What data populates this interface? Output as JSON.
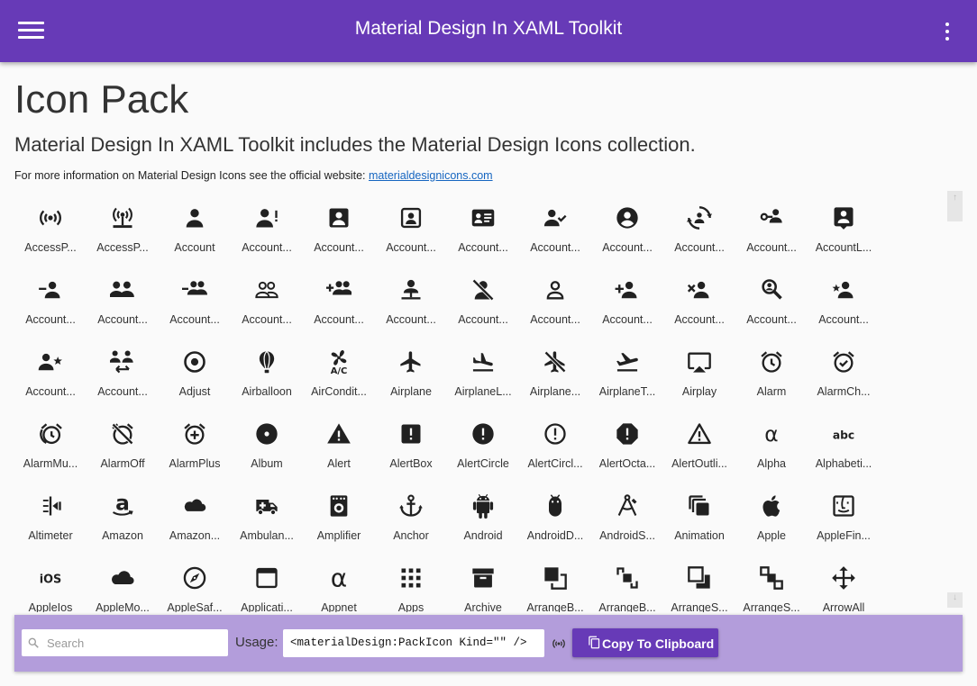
{
  "app": {
    "title": "Material Design In XAML Toolkit",
    "accent": "#673ab7",
    "panel_color": "#b39ddb"
  },
  "header": {
    "menu_icon": "hamburger-menu-icon",
    "more_icon": "more-vert-icon"
  },
  "page": {
    "title": "Icon Pack",
    "subtitle": "Material Design In XAML Toolkit includes the Material Design Icons collection.",
    "info_text": "For more information on Material Design Icons see the official website: ",
    "info_link": "materialdesignicons.com"
  },
  "icons": [
    {
      "label": "AccessP...",
      "icon": "access-point-icon"
    },
    {
      "label": "AccessP...",
      "icon": "access-point-network-icon"
    },
    {
      "label": "Account",
      "icon": "account-icon"
    },
    {
      "label": "Account...",
      "icon": "account-alert-icon"
    },
    {
      "label": "Account...",
      "icon": "account-box-icon"
    },
    {
      "label": "Account...",
      "icon": "account-box-outline-icon"
    },
    {
      "label": "Account...",
      "icon": "account-card-details-icon"
    },
    {
      "label": "Account...",
      "icon": "account-check-icon"
    },
    {
      "label": "Account...",
      "icon": "account-circle-icon"
    },
    {
      "label": "Account...",
      "icon": "account-convert-icon"
    },
    {
      "label": "Account...",
      "icon": "account-key-icon"
    },
    {
      "label": "AccountL...",
      "icon": "account-location-icon"
    },
    {
      "label": "Account...",
      "icon": "account-minus-icon"
    },
    {
      "label": "Account...",
      "icon": "account-multiple-icon"
    },
    {
      "label": "Account...",
      "icon": "account-multiple-minus-icon"
    },
    {
      "label": "Account...",
      "icon": "account-multiple-outline-icon"
    },
    {
      "label": "Account...",
      "icon": "account-multiple-plus-icon"
    },
    {
      "label": "Account...",
      "icon": "account-network-icon"
    },
    {
      "label": "Account...",
      "icon": "account-off-icon"
    },
    {
      "label": "Account...",
      "icon": "account-outline-icon"
    },
    {
      "label": "Account...",
      "icon": "account-plus-icon"
    },
    {
      "label": "Account...",
      "icon": "account-remove-icon"
    },
    {
      "label": "Account...",
      "icon": "account-search-icon"
    },
    {
      "label": "Account...",
      "icon": "account-star-icon"
    },
    {
      "label": "Account...",
      "icon": "account-star-variant-icon"
    },
    {
      "label": "Account...",
      "icon": "account-switch-icon"
    },
    {
      "label": "Adjust",
      "icon": "adjust-icon"
    },
    {
      "label": "Airballoon",
      "icon": "airballoon-icon"
    },
    {
      "label": "AirCondit...",
      "icon": "air-conditioner-icon"
    },
    {
      "label": "Airplane",
      "icon": "airplane-icon"
    },
    {
      "label": "AirplaneL...",
      "icon": "airplane-landing-icon"
    },
    {
      "label": "Airplane...",
      "icon": "airplane-off-icon"
    },
    {
      "label": "AirplaneT...",
      "icon": "airplane-takeoff-icon"
    },
    {
      "label": "Airplay",
      "icon": "airplay-icon"
    },
    {
      "label": "Alarm",
      "icon": "alarm-icon"
    },
    {
      "label": "AlarmCh...",
      "icon": "alarm-check-icon"
    },
    {
      "label": "AlarmMu...",
      "icon": "alarm-multiple-icon"
    },
    {
      "label": "AlarmOff",
      "icon": "alarm-off-icon"
    },
    {
      "label": "AlarmPlus",
      "icon": "alarm-plus-icon"
    },
    {
      "label": "Album",
      "icon": "album-icon"
    },
    {
      "label": "Alert",
      "icon": "alert-icon"
    },
    {
      "label": "AlertBox",
      "icon": "alert-box-icon"
    },
    {
      "label": "AlertCircle",
      "icon": "alert-circle-icon"
    },
    {
      "label": "AlertCircl...",
      "icon": "alert-circle-outline-icon"
    },
    {
      "label": "AlertOcta...",
      "icon": "alert-octagon-icon"
    },
    {
      "label": "AlertOutli...",
      "icon": "alert-outline-icon"
    },
    {
      "label": "Alpha",
      "icon": "alpha-icon"
    },
    {
      "label": "Alphabeti...",
      "icon": "alphabetical-icon"
    },
    {
      "label": "Altimeter",
      "icon": "altimeter-icon"
    },
    {
      "label": "Amazon",
      "icon": "amazon-icon"
    },
    {
      "label": "Amazon...",
      "icon": "amazon-clouddrive-icon"
    },
    {
      "label": "Ambulan...",
      "icon": "ambulance-icon"
    },
    {
      "label": "Amplifier",
      "icon": "amplifier-icon"
    },
    {
      "label": "Anchor",
      "icon": "anchor-icon"
    },
    {
      "label": "Android",
      "icon": "android-icon"
    },
    {
      "label": "AndroidD...",
      "icon": "android-debug-bridge-icon"
    },
    {
      "label": "AndroidS...",
      "icon": "android-studio-icon"
    },
    {
      "label": "Animation",
      "icon": "animation-icon"
    },
    {
      "label": "Apple",
      "icon": "apple-icon"
    },
    {
      "label": "AppleFin...",
      "icon": "apple-finder-icon"
    },
    {
      "label": "AppleIos",
      "icon": "apple-ios-icon"
    },
    {
      "label": "AppleMo...",
      "icon": "apple-mobileme-icon"
    },
    {
      "label": "AppleSaf...",
      "icon": "apple-safari-icon"
    },
    {
      "label": "Applicati...",
      "icon": "application-icon"
    },
    {
      "label": "Appnet",
      "icon": "appnet-icon"
    },
    {
      "label": "Apps",
      "icon": "apps-icon"
    },
    {
      "label": "Archive",
      "icon": "archive-icon"
    },
    {
      "label": "ArrangeB...",
      "icon": "arrange-bring-forward-icon"
    },
    {
      "label": "ArrangeB...",
      "icon": "arrange-bring-to-front-icon"
    },
    {
      "label": "ArrangeS...",
      "icon": "arrange-send-backward-icon"
    },
    {
      "label": "ArrangeS...",
      "icon": "arrange-send-to-back-icon"
    },
    {
      "label": "ArrowAll",
      "icon": "arrow-all-icon"
    }
  ],
  "footer": {
    "search_placeholder": "Search",
    "search_value": "",
    "usage_label": "Usage:",
    "usage_code": "<materialDesign:PackIcon Kind=\"\" />",
    "usage_icon": "access-point-icon",
    "copy_label": "Copy To Clipboard",
    "copy_icon": "content-copy-icon"
  }
}
